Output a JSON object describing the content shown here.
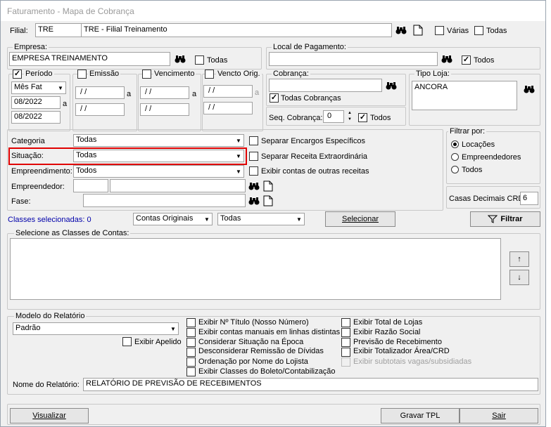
{
  "window": {
    "title": "Faturamento - Mapa de Cobrança"
  },
  "filial": {
    "label": "Filial:",
    "code": "TRE",
    "name": "TRE - Filial Treinamento",
    "varias": "Várias",
    "todas": "Todas"
  },
  "empresa": {
    "legend": "Empresa:",
    "value": "EMPRESA TREINAMENTO",
    "todas": "Todas"
  },
  "local": {
    "legend": "Local de Pagamento:",
    "value": "",
    "todos": "Todos"
  },
  "periodo": {
    "legend": "Período",
    "mode": "Mês Fat",
    "from": "08/2022",
    "sep": "a",
    "to": "08/2022"
  },
  "emissao": {
    "legend": "Emissão",
    "from": " / /",
    "sep": "a",
    "to": " / /"
  },
  "vencimento": {
    "legend": "Vencimento",
    "from": " / /",
    "sep": "a",
    "to": " / /"
  },
  "vencto_orig": {
    "legend": "Vencto Orig.",
    "from": " / /",
    "sep": "a",
    "to": " / /"
  },
  "cobranca": {
    "legend": "Cobrança:",
    "value": "",
    "todas": "Todas Cobranças",
    "seq_label": "Seq. Cobrança:",
    "seq_value": "0",
    "todos": "Todos"
  },
  "tipo_loja": {
    "legend": "Tipo Loja:",
    "value": "ANCORA"
  },
  "filters": {
    "categoria_label": "Categoria",
    "categoria_value": "Todas",
    "situacao_label": "Situação:",
    "situacao_value": "Todas",
    "empreendimento_label": "Empreendimento:",
    "empreendimento_value": "Todos",
    "empreendedor_label": "Empreendedor:",
    "fase_label": "Fase:",
    "sep_encargos": "Separar Encargos Específicos",
    "sep_receita": "Separar Receita Extraordinária",
    "exibir_contas": "Exibir contas de outras receitas"
  },
  "filtrar_por": {
    "legend": "Filtrar por:",
    "opt1": "Locações",
    "opt2": "Empreendedores",
    "opt3": "Todos"
  },
  "casas": {
    "label": "Casas Decimais CRD",
    "value": "6"
  },
  "classes": {
    "selected": "Classes selecionadas: 0",
    "tipo": "Contas Originais",
    "tipo2": "Todas",
    "selecionar": "Selecionar",
    "filtrar": "Filtrar",
    "legend": "Selecione as Classes de Contas:"
  },
  "modelo": {
    "legend": "Modelo do Relatório",
    "value": "Padrão",
    "exibir_apelido": "Exibir Apelido"
  },
  "options_left": [
    "Exibir Nº Título (Nosso Número)",
    "Exibir contas manuais em linhas distintas",
    "Considerar Situação na Época",
    "Desconsiderar Remissão de Dívidas",
    "Ordenação por Nome do Lojista",
    "Exibir Classes do Boleto/Contabilização"
  ],
  "options_right": [
    "Exibir Total de Lojas",
    "Exibir Razão Social",
    "Previsão de Recebimento",
    "Exibir Totalizador Área/CRD",
    "Exibir subtotais vagas/subsidiadas"
  ],
  "nome_relatorio": {
    "label": "Nome do Relatório:",
    "value": "RELATÓRIO DE PREVISÃO DE RECEBIMENTOS"
  },
  "footer": {
    "visualizar": "Visualizar",
    "gravar": "Gravar TPL",
    "sair": "Sair"
  }
}
